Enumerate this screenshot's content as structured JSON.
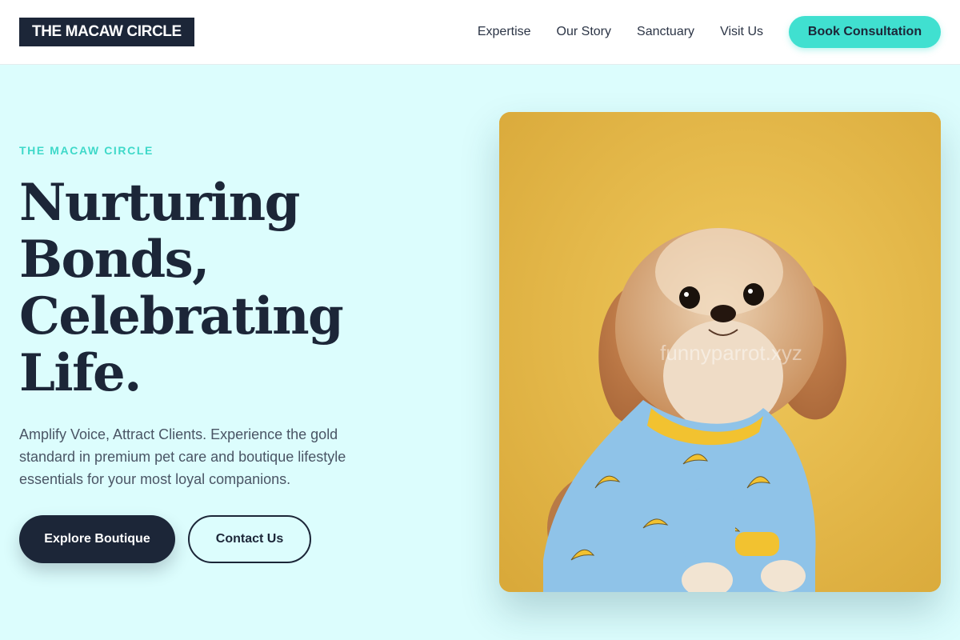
{
  "header": {
    "logo": "THE MACAW CIRCLE",
    "nav": [
      "Expertise",
      "Our Story",
      "Sanctuary",
      "Visit Us"
    ],
    "cta": "Book Consultation"
  },
  "hero": {
    "eyebrow": "THE MACAW CIRCLE",
    "title": "Nurturing Bonds, Celebrating Life.",
    "description": "Amplify Voice, Attract Clients. Experience the gold standard in premium pet care and boutique lifestyle essentials for your most loyal companions.",
    "primary_button": "Explore Boutique",
    "secondary_button": "Contact Us",
    "image_watermark": "funnyparrot.xyz"
  },
  "colors": {
    "accent": "#40e0d0",
    "dark": "#1c2638",
    "background": "#dcfdfd",
    "photo_background": "#e7bc4c"
  }
}
